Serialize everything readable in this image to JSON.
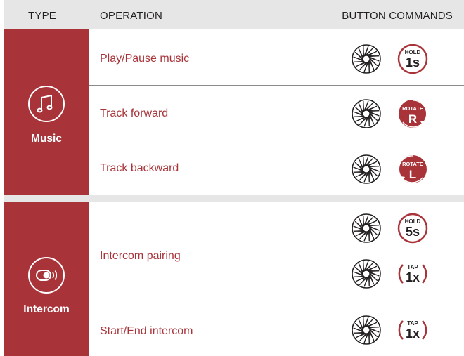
{
  "header": {
    "type": "TYPE",
    "operation": "OPERATION",
    "commands": "BUTTON COMMANDS"
  },
  "groups": [
    {
      "label": "Music",
      "icon": "music-note-icon",
      "rows": [
        {
          "operation": "Play/Pause music",
          "commands": [
            {
              "kind": "hold",
              "top": "HOLD",
              "main": "1s"
            }
          ]
        },
        {
          "operation": "Track forward",
          "commands": [
            {
              "kind": "rotate",
              "top": "ROTATE",
              "main": "R"
            }
          ]
        },
        {
          "operation": "Track backward",
          "commands": [
            {
              "kind": "rotate",
              "top": "ROTATE",
              "main": "L"
            }
          ]
        }
      ]
    },
    {
      "label": "Intercom",
      "icon": "headset-signal-icon",
      "rows": [
        {
          "operation": "Intercom pairing",
          "commands": [
            {
              "kind": "hold",
              "top": "HOLD",
              "main": "5s"
            },
            {
              "kind": "tap",
              "top": "TAP",
              "main": "1x"
            }
          ]
        },
        {
          "operation": "Start/End intercom",
          "commands": [
            {
              "kind": "tap",
              "top": "TAP",
              "main": "1x"
            }
          ]
        }
      ]
    }
  ],
  "colors": {
    "accent": "#a8343a",
    "header_bg": "#e6e6e6",
    "wheel_icon": "jog-dial-icon"
  }
}
